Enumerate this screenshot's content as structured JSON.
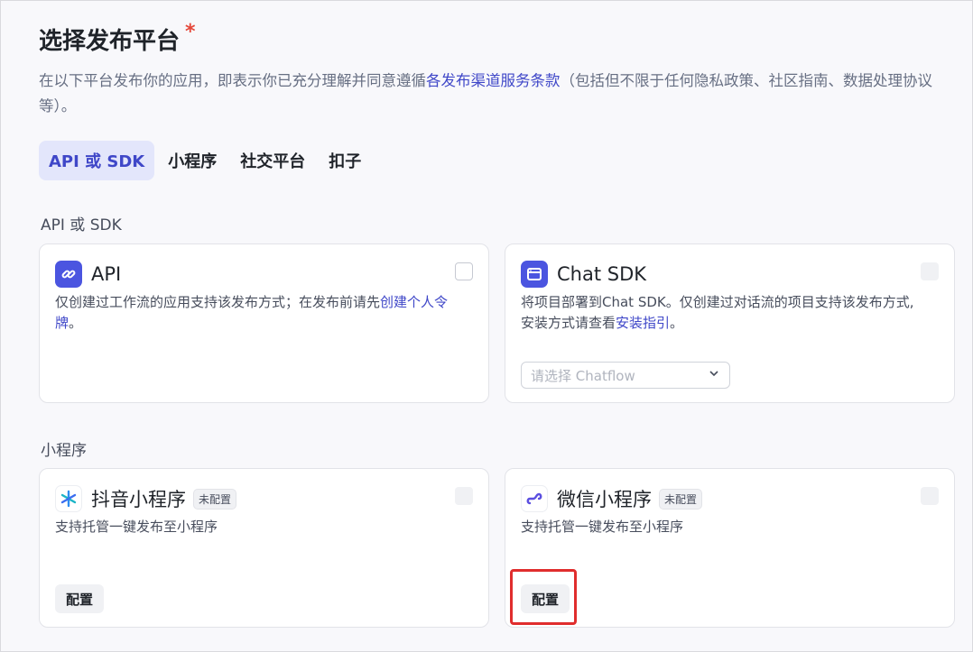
{
  "header": {
    "title": "选择发布平台",
    "required_mark": "*",
    "desc_prefix": "在以下平台发布你的应用，即表示你已充分理解并同意遵循",
    "desc_link": "各发布渠道服务条款",
    "desc_suffix": "（包括但不限于任何隐私政策、社区指南、数据处理协议等）。"
  },
  "tabs": [
    {
      "label": "API 或 SDK",
      "active": true
    },
    {
      "label": "小程序"
    },
    {
      "label": "社交平台"
    },
    {
      "label": "扣子"
    }
  ],
  "sections": {
    "api_sdk_label": "API 或 SDK",
    "mini_label": "小程序"
  },
  "cards": {
    "api": {
      "title": "API",
      "desc_prefix": "仅创建过工作流的应用支持该发布方式；在发布前请先",
      "desc_link": "创建个人令牌",
      "desc_suffix": "。"
    },
    "chat_sdk": {
      "title": "Chat SDK",
      "desc_prefix": "将项目部署到Chat SDK。仅创建过对话流的项目支持该发布方式,安装方式请查看",
      "desc_link": "安装指引",
      "desc_suffix": "。",
      "select_placeholder": "请选择 Chatflow"
    },
    "douyin": {
      "title": "抖音小程序",
      "badge": "未配置",
      "desc": "支持托管一键发布至小程序",
      "button": "配置"
    },
    "wechat": {
      "title": "微信小程序",
      "badge": "未配置",
      "desc": "支持托管一键发布至小程序",
      "button": "配置"
    }
  },
  "colors": {
    "accent": "#3f47c8",
    "tab_active_bg": "#e3e6fb",
    "highlight": "#e02d2d",
    "required": "#e5483a"
  }
}
